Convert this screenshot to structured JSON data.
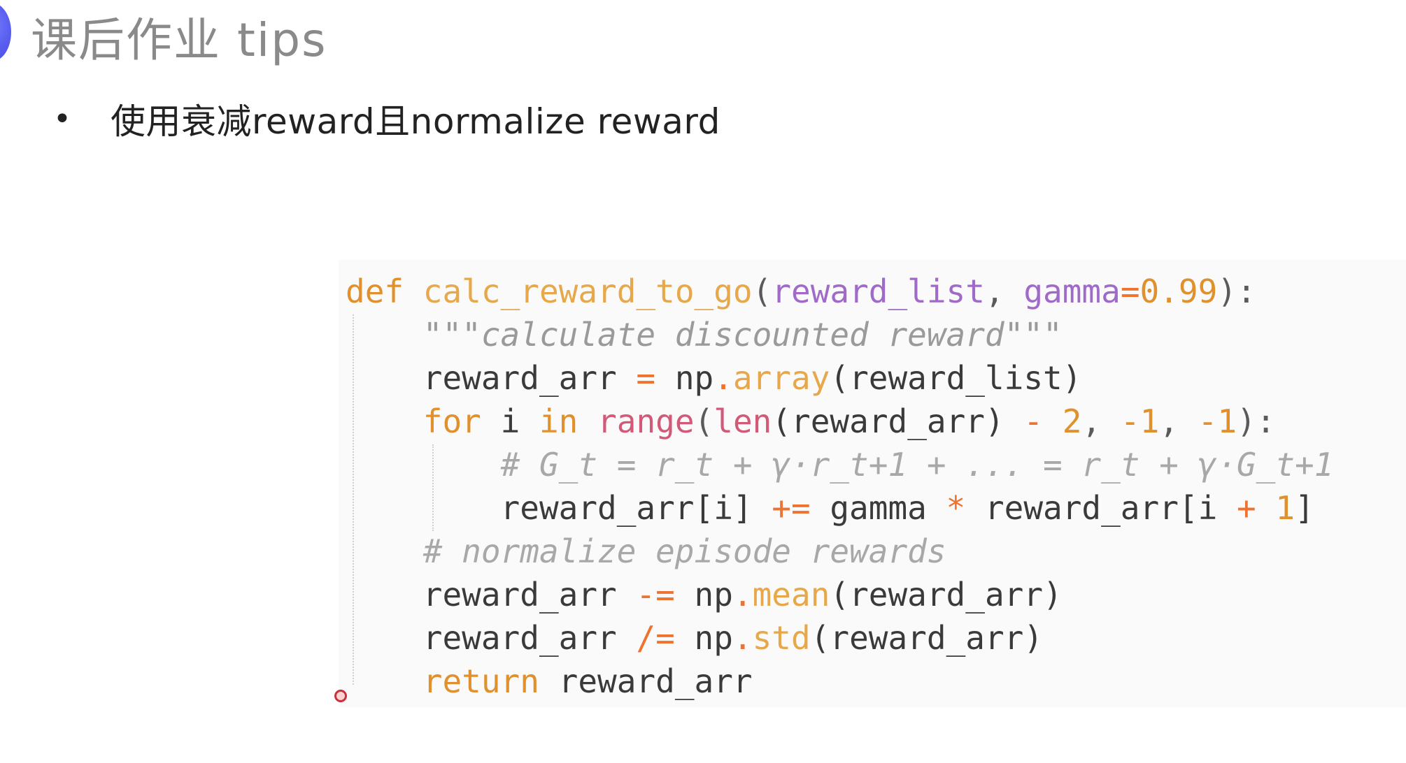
{
  "slide": {
    "title": "课后作业 tips",
    "bullet_marker": "•",
    "bullet_text": "使用衰减reward且normalize reward"
  },
  "code": {
    "language": "python",
    "colors": {
      "keyword": "#e0902c",
      "function_name": "#e6a84a",
      "parameter": "#a06ac8",
      "operator": "#ee7230",
      "builtin": "#d05a78",
      "comment": "#a8a8a8",
      "background": "#fafafa"
    },
    "lines": [
      {
        "tokens": [
          {
            "t": "def",
            "c": "kw"
          },
          {
            "t": " ",
            "c": "plain"
          },
          {
            "t": "calc_reward_to_go",
            "c": "fn"
          },
          {
            "t": "(",
            "c": "punct"
          },
          {
            "t": "reward_list",
            "c": "param"
          },
          {
            "t": ", ",
            "c": "punct"
          },
          {
            "t": "gamma",
            "c": "param"
          },
          {
            "t": "=",
            "c": "op"
          },
          {
            "t": "0.99",
            "c": "num"
          },
          {
            "t": "):",
            "c": "punct"
          }
        ]
      },
      {
        "tokens": [
          {
            "t": "    ",
            "c": "plain"
          },
          {
            "t": "\"\"\"calculate discounted reward\"\"\"",
            "c": "doc"
          }
        ]
      },
      {
        "tokens": [
          {
            "t": "    reward_arr ",
            "c": "plain"
          },
          {
            "t": "=",
            "c": "op"
          },
          {
            "t": " np",
            "c": "plain"
          },
          {
            "t": ".",
            "c": "op"
          },
          {
            "t": "array",
            "c": "attr"
          },
          {
            "t": "(reward_list)",
            "c": "plain"
          }
        ]
      },
      {
        "tokens": [
          {
            "t": "    ",
            "c": "plain"
          },
          {
            "t": "for",
            "c": "kw"
          },
          {
            "t": " i ",
            "c": "plain"
          },
          {
            "t": "in",
            "c": "kw"
          },
          {
            "t": " ",
            "c": "plain"
          },
          {
            "t": "range",
            "c": "builtin"
          },
          {
            "t": "(",
            "c": "punct"
          },
          {
            "t": "len",
            "c": "builtin"
          },
          {
            "t": "(reward_arr) ",
            "c": "plain"
          },
          {
            "t": "-",
            "c": "op"
          },
          {
            "t": " ",
            "c": "plain"
          },
          {
            "t": "2",
            "c": "num"
          },
          {
            "t": ", ",
            "c": "punct"
          },
          {
            "t": "-1",
            "c": "num"
          },
          {
            "t": ", ",
            "c": "punct"
          },
          {
            "t": "-1",
            "c": "num"
          },
          {
            "t": "):",
            "c": "punct"
          }
        ]
      },
      {
        "tokens": [
          {
            "t": "        ",
            "c": "plain"
          },
          {
            "t": "# G_t = r_t + γ·r_t+1 + ... = r_t + γ·G_t+1",
            "c": "cmt"
          }
        ]
      },
      {
        "tokens": [
          {
            "t": "        reward_arr[i] ",
            "c": "plain"
          },
          {
            "t": "+=",
            "c": "op"
          },
          {
            "t": " gamma ",
            "c": "plain"
          },
          {
            "t": "*",
            "c": "op"
          },
          {
            "t": " reward_arr[i ",
            "c": "plain"
          },
          {
            "t": "+",
            "c": "op"
          },
          {
            "t": " ",
            "c": "plain"
          },
          {
            "t": "1",
            "c": "num"
          },
          {
            "t": "]",
            "c": "plain"
          }
        ]
      },
      {
        "tokens": [
          {
            "t": "    ",
            "c": "plain"
          },
          {
            "t": "# normalize episode rewards",
            "c": "cmt"
          }
        ]
      },
      {
        "tokens": [
          {
            "t": "    reward_arr ",
            "c": "plain"
          },
          {
            "t": "-=",
            "c": "op"
          },
          {
            "t": " np",
            "c": "plain"
          },
          {
            "t": ".",
            "c": "op"
          },
          {
            "t": "mean",
            "c": "attr"
          },
          {
            "t": "(reward_arr)",
            "c": "plain"
          }
        ]
      },
      {
        "tokens": [
          {
            "t": "    reward_arr ",
            "c": "plain"
          },
          {
            "t": "/=",
            "c": "op"
          },
          {
            "t": " np",
            "c": "plain"
          },
          {
            "t": ".",
            "c": "op"
          },
          {
            "t": "std",
            "c": "attr"
          },
          {
            "t": "(reward_arr)",
            "c": "plain"
          }
        ]
      },
      {
        "tokens": [
          {
            "t": "    ",
            "c": "plain"
          },
          {
            "t": "return",
            "c": "kw"
          },
          {
            "t": " reward_arr",
            "c": "plain"
          }
        ]
      }
    ]
  },
  "icons": {
    "accent": "accent-circle-icon",
    "cursor": "cursor-dot-icon"
  }
}
